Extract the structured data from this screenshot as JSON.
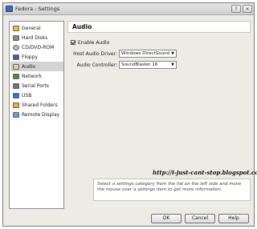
{
  "window": {
    "title": "Fedora - Settings",
    "help_glyph": "?",
    "close_glyph": "×"
  },
  "sidebar": {
    "items": [
      {
        "label": "General",
        "icon": "general-icon",
        "color": "#f0c030"
      },
      {
        "label": "Hard Disks",
        "icon": "hard-disk-icon",
        "color": "#8a8a8a"
      },
      {
        "label": "CD/DVD-ROM",
        "icon": "cd-dvd-icon",
        "color": "#b8b8d8"
      },
      {
        "label": "Floppy",
        "icon": "floppy-icon",
        "color": "#4060a0"
      },
      {
        "label": "Audio",
        "icon": "audio-icon",
        "color": "#d8d0a0",
        "selected": true
      },
      {
        "label": "Network",
        "icon": "network-icon",
        "color": "#4a8a4a"
      },
      {
        "label": "Serial Ports",
        "icon": "serial-port-icon",
        "color": "#707070"
      },
      {
        "label": "USB",
        "icon": "usb-icon",
        "color": "#4070c0"
      },
      {
        "label": "Shared Folders",
        "icon": "shared-folder-icon",
        "color": "#e0b040"
      },
      {
        "label": "Remote Display",
        "icon": "remote-display-icon",
        "color": "#60a0d0"
      }
    ]
  },
  "audio": {
    "heading": "Audio",
    "enable_label": "Enable Audio",
    "enable_checked": true,
    "host_driver_label": "Host Audio Driver:",
    "host_driver_value": "Windows DirectSound",
    "controller_label": "Audio Controller:",
    "controller_value": "SoundBlaster 16"
  },
  "watermark": "http://i-just-cant-stop.blogspot.com/",
  "info_text": "Select a settings category from the list on the left side and move the mouse over a settings item to get more information.",
  "buttons": {
    "ok": "OK",
    "cancel": "Cancel",
    "help": "Help"
  },
  "colors": {
    "selected_bg": "#d3d3d3",
    "window_bg": "#ecebe6"
  }
}
